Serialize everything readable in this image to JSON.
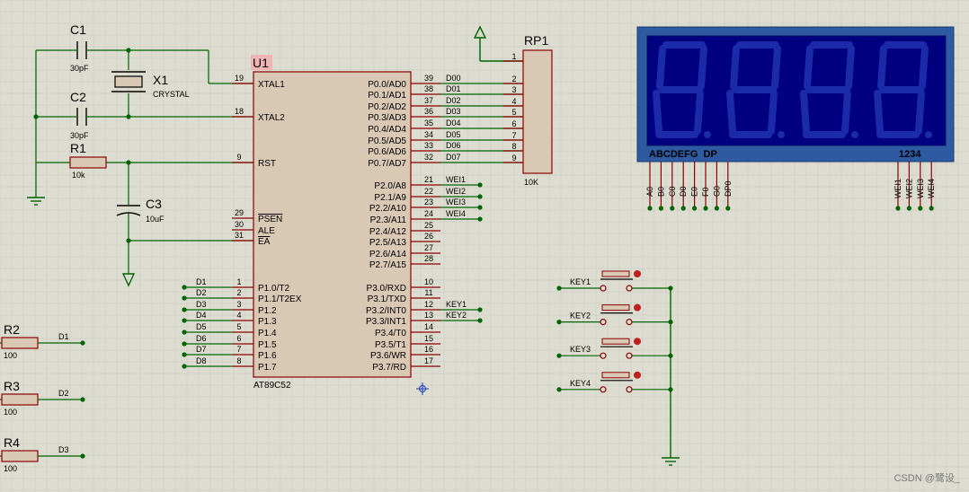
{
  "colors": {
    "background": "#dcdcd0",
    "grid": "#c8c8bc",
    "wire": "#006400",
    "body": "#d9c8b4",
    "body_stroke": "#8b0000",
    "pin": "#8b0000",
    "label": "#000000",
    "refdes_bg": "#f0b4b4",
    "lcd_frame": "#2d5aa0",
    "lcd_screen": "#000080",
    "lcd_text": "#000000",
    "probe": "#3050c0"
  },
  "mcu": {
    "ref": "U1",
    "part": "AT89C52",
    "left_pins": [
      {
        "num": "19",
        "name": "XTAL1"
      },
      {
        "num": "18",
        "name": "XTAL2"
      },
      {
        "num": "9",
        "name": "RST"
      },
      {
        "num": "29",
        "name": "PSEN"
      },
      {
        "num": "30",
        "name": "ALE"
      },
      {
        "num": "31",
        "name": "EA"
      },
      {
        "num": "1",
        "name": "P1.0/T2"
      },
      {
        "num": "2",
        "name": "P1.1/T2EX"
      },
      {
        "num": "3",
        "name": "P1.2"
      },
      {
        "num": "4",
        "name": "P1.3"
      },
      {
        "num": "5",
        "name": "P1.4"
      },
      {
        "num": "6",
        "name": "P1.5"
      },
      {
        "num": "7",
        "name": "P1.6"
      },
      {
        "num": "8",
        "name": "P1.7"
      }
    ],
    "right_pins": [
      {
        "num": "39",
        "name": "P0.0/AD0"
      },
      {
        "num": "38",
        "name": "P0.1/AD1"
      },
      {
        "num": "37",
        "name": "P0.2/AD2"
      },
      {
        "num": "36",
        "name": "P0.3/AD3"
      },
      {
        "num": "35",
        "name": "P0.4/AD4"
      },
      {
        "num": "34",
        "name": "P0.5/AD5"
      },
      {
        "num": "33",
        "name": "P0.6/AD6"
      },
      {
        "num": "32",
        "name": "P0.7/AD7"
      },
      {
        "num": "21",
        "name": "P2.0/A8"
      },
      {
        "num": "22",
        "name": "P2.1/A9"
      },
      {
        "num": "23",
        "name": "P2.2/A10"
      },
      {
        "num": "24",
        "name": "P2.3/A11"
      },
      {
        "num": "25",
        "name": "P2.4/A12"
      },
      {
        "num": "26",
        "name": "P2.5/A13"
      },
      {
        "num": "27",
        "name": "P2.6/A14"
      },
      {
        "num": "28",
        "name": "P2.7/A15"
      },
      {
        "num": "10",
        "name": "P3.0/RXD"
      },
      {
        "num": "11",
        "name": "P3.1/TXD"
      },
      {
        "num": "12",
        "name": "P3.2/INT0"
      },
      {
        "num": "13",
        "name": "P3.3/INT1"
      },
      {
        "num": "14",
        "name": "P3.4/T0"
      },
      {
        "num": "15",
        "name": "P3.5/T1"
      },
      {
        "num": "16",
        "name": "P3.6/WR"
      },
      {
        "num": "17",
        "name": "P3.7/RD"
      }
    ],
    "p0_nets": [
      "D00",
      "D01",
      "D02",
      "D03",
      "D04",
      "D05",
      "D06",
      "D07"
    ],
    "p2_nets": [
      "WEI1",
      "WEI2",
      "WEI3",
      "WEI4"
    ],
    "p3_nets": [
      "KEY1",
      "KEY2"
    ],
    "p1_nets": [
      "D1",
      "D2",
      "D3",
      "D4",
      "D5",
      "D6",
      "D7",
      "D8"
    ]
  },
  "components": {
    "c1": {
      "ref": "C1",
      "value": "30pF"
    },
    "c2": {
      "ref": "C2",
      "value": "30pF"
    },
    "x1": {
      "ref": "X1",
      "value": "CRYSTAL"
    },
    "r1": {
      "ref": "R1",
      "value": "10k"
    },
    "c3": {
      "ref": "C3",
      "value": "10uF"
    },
    "rp1": {
      "ref": "RP1",
      "value": "10K",
      "pins": [
        "1",
        "2",
        "3",
        "4",
        "5",
        "6",
        "7",
        "8",
        "9"
      ]
    },
    "leds": [
      {
        "ref": "R2",
        "value": "100",
        "net": "D1"
      },
      {
        "ref": "R3",
        "value": "100",
        "net": "D2"
      },
      {
        "ref": "R4",
        "value": "100",
        "net": "D3"
      }
    ],
    "keys": [
      {
        "net": "KEY1"
      },
      {
        "net": "KEY2"
      },
      {
        "net": "KEY3"
      },
      {
        "net": "KEY4"
      }
    ]
  },
  "display": {
    "seg_label": "ABCDEFG  DP",
    "digit_label": "1234",
    "seg_pins": [
      "A0",
      "B0",
      "C0",
      "D0",
      "E0",
      "F0",
      "G0",
      "DP0"
    ],
    "com_pins": [
      "WEI1",
      "WEI2",
      "WEI3",
      "WEI4"
    ],
    "digits": 4
  },
  "watermark": "CSDN @鹭设_"
}
